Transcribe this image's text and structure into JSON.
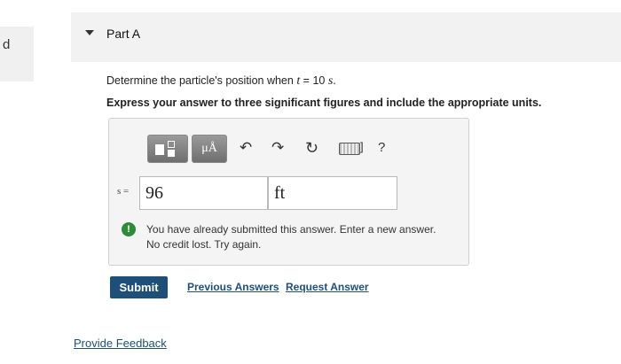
{
  "sidebar": {
    "fragment": "d"
  },
  "part": {
    "title": "Part A"
  },
  "question": {
    "prefix": "Determine the particle's position when ",
    "variable": "t",
    "middle": " = 10 ",
    "unit": "s",
    "suffix": "."
  },
  "instruction": "Express your answer to three significant figures and include the appropriate units.",
  "toolbar": {
    "units_label": "μÅ",
    "undo_glyph": "↶",
    "redo_glyph": "↷",
    "reset_glyph": "↻",
    "keyboard_bracket": "]",
    "help_label": "?"
  },
  "answer": {
    "variable_label": "s =",
    "value": "96",
    "unit": "ft"
  },
  "alert": {
    "icon": "exclamation-icon",
    "line1": "You have already submitted this answer. Enter a new answer.",
    "line2": "No credit lost. Try again."
  },
  "actions": {
    "submit_label": "Submit",
    "previous_answers_label": "Previous Answers",
    "request_answer_label": "Request Answer"
  },
  "footer": {
    "feedback_label": "Provide Feedback"
  },
  "colors": {
    "accent": "#1d4f78",
    "alert": "#2e8b3a",
    "header_bg": "#f2f2f2"
  }
}
